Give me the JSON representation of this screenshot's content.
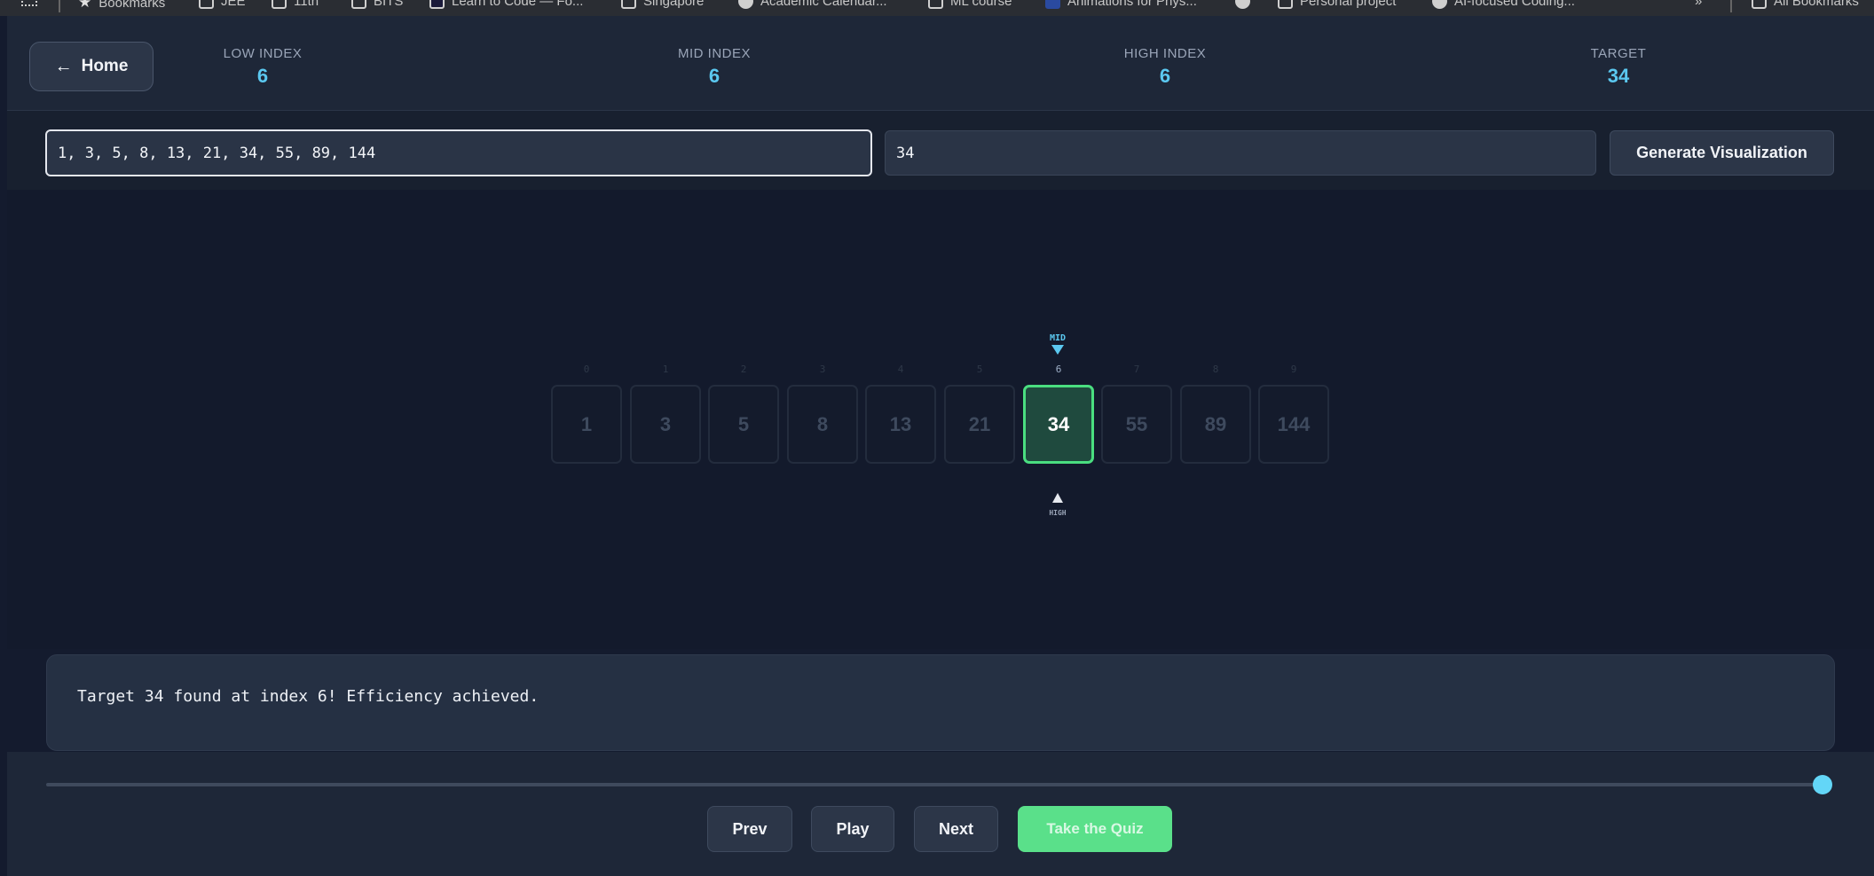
{
  "bookmarks": {
    "items": [
      {
        "label": "Bookmarks",
        "icon": "star-icon"
      },
      {
        "label": "JEE",
        "icon": "folder-icon"
      },
      {
        "label": "11th",
        "icon": "folder-icon"
      },
      {
        "label": "BITS",
        "icon": "folder-icon"
      },
      {
        "label": "Learn to Code — Fo...",
        "icon": "site-icon"
      },
      {
        "label": "Singapore",
        "icon": "folder-icon"
      },
      {
        "label": "Academic Calendar...",
        "icon": "globe-icon"
      },
      {
        "label": "ML course",
        "icon": "folder-icon"
      },
      {
        "label": "Animations for Phys...",
        "icon": "site-icon"
      },
      {
        "label": "",
        "icon": "globe-icon"
      },
      {
        "label": "Personal project",
        "icon": "folder-icon"
      },
      {
        "label": "AI-focused Coding...",
        "icon": "globe-icon"
      },
      {
        "label": "All Bookmarks",
        "icon": "folder-icon"
      }
    ],
    "overflow": "»"
  },
  "header": {
    "home_label": "Home",
    "stats": {
      "low": {
        "label": "LOW INDEX",
        "value": "6"
      },
      "mid": {
        "label": "MID INDEX",
        "value": "6"
      },
      "high": {
        "label": "HIGH INDEX",
        "value": "6"
      },
      "target": {
        "label": "TARGET",
        "value": "34"
      }
    }
  },
  "controls": {
    "array_value": "1, 3, 5, 8, 13, 21, 34, 55, 89, 144",
    "target_value": "34",
    "generate_label": "Generate Visualization"
  },
  "visualization": {
    "cells": [
      {
        "index": "0",
        "value": "1"
      },
      {
        "index": "1",
        "value": "3"
      },
      {
        "index": "2",
        "value": "5"
      },
      {
        "index": "3",
        "value": "8"
      },
      {
        "index": "4",
        "value": "13"
      },
      {
        "index": "5",
        "value": "21"
      },
      {
        "index": "6",
        "value": "34"
      },
      {
        "index": "7",
        "value": "55"
      },
      {
        "index": "8",
        "value": "89"
      },
      {
        "index": "9",
        "value": "144"
      }
    ],
    "active_index": 6,
    "mid_pointer_label": "MID",
    "high_pointer_label": "HIGH"
  },
  "message": "Target 34 found at index 6! Efficiency achieved.",
  "footer": {
    "progress": 1.0,
    "prev_label": "Prev",
    "play_label": "Play",
    "next_label": "Next",
    "quiz_label": "Take the Quiz"
  },
  "colors": {
    "accent": "#5bc8f0",
    "success": "#4ade80",
    "quiz": "#5ae08a"
  }
}
